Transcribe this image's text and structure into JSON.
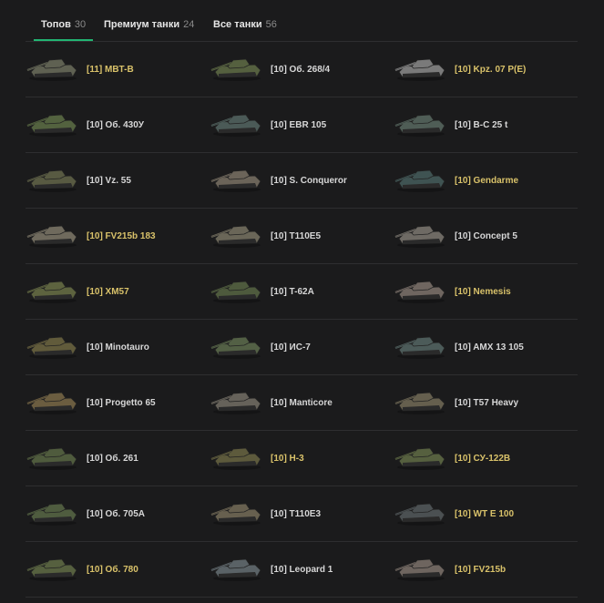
{
  "tabs": [
    {
      "label": "Топов",
      "count": "30",
      "active": true
    },
    {
      "label": "Премиум танки",
      "count": "24",
      "active": false
    },
    {
      "label": "Все танки",
      "count": "56",
      "active": false
    }
  ],
  "tanks": [
    {
      "name": "[11] MBT-B",
      "premium": true,
      "color": "#5f6152"
    },
    {
      "name": "[10] Об. 268/4",
      "premium": false,
      "color": "#55603f"
    },
    {
      "name": "[10] Kpz. 07 P(E)",
      "premium": true,
      "color": "#7a7a7a"
    },
    {
      "name": "[10] Об. 430У",
      "premium": false,
      "color": "#53623f"
    },
    {
      "name": "[10] EBR 105",
      "premium": false,
      "color": "#4b5a57"
    },
    {
      "name": "[10] В-С 25 t",
      "premium": false,
      "color": "#4f5d56"
    },
    {
      "name": "[10] Vz. 55",
      "premium": false,
      "color": "#585a42"
    },
    {
      "name": "[10] S. Conqueror",
      "premium": false,
      "color": "#6b6459"
    },
    {
      "name": "[10] Gendarme",
      "premium": true,
      "color": "#3f5352"
    },
    {
      "name": "[10] FV215b 183",
      "premium": true,
      "color": "#6f6a5d"
    },
    {
      "name": "[10] T110E5",
      "premium": false,
      "color": "#6a6658"
    },
    {
      "name": "[10] Concept 5",
      "premium": false,
      "color": "#6e6a64"
    },
    {
      "name": "[10] XM57",
      "premium": true,
      "color": "#5d633f"
    },
    {
      "name": "[10] T-62A",
      "premium": false,
      "color": "#4e5a3d"
    },
    {
      "name": "[10] Nemesis",
      "premium": true,
      "color": "#6f6660"
    },
    {
      "name": "[10] Minotauro",
      "premium": false,
      "color": "#615b3b"
    },
    {
      "name": "[10] ИС-7",
      "premium": false,
      "color": "#536045"
    },
    {
      "name": "[10] AMX 13 105",
      "premium": false,
      "color": "#4c5b59"
    },
    {
      "name": "[10] Progetto 65",
      "premium": false,
      "color": "#6b5d40"
    },
    {
      "name": "[10] Manticore",
      "premium": false,
      "color": "#66625a"
    },
    {
      "name": "[10] T57 Heavy",
      "premium": false,
      "color": "#655f4e"
    },
    {
      "name": "[10] Об. 261",
      "premium": false,
      "color": "#4f5b3d"
    },
    {
      "name": "[10] H-3",
      "premium": true,
      "color": "#5d5a3c"
    },
    {
      "name": "[10] СУ-122В",
      "premium": true,
      "color": "#56603f"
    },
    {
      "name": "[10] Об. 705А",
      "premium": false,
      "color": "#4f5c3f"
    },
    {
      "name": "[10] T110E3",
      "premium": false,
      "color": "#67604f"
    },
    {
      "name": "[10] WT E 100",
      "premium": true,
      "color": "#4b5052"
    },
    {
      "name": "[10] Об. 780",
      "premium": true,
      "color": "#56603f"
    },
    {
      "name": "[10] Leopard 1",
      "premium": false,
      "color": "#5a6266"
    },
    {
      "name": "[10] FV215b",
      "premium": true,
      "color": "#6e655f"
    }
  ]
}
